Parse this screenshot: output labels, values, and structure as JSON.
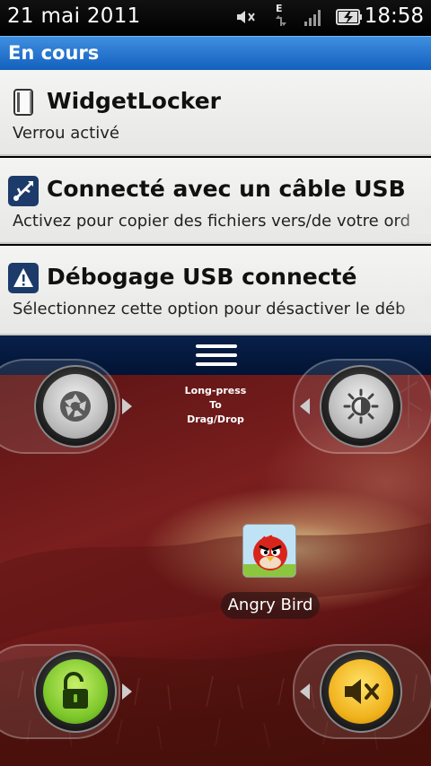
{
  "status_bar": {
    "date": "21 mai 2011",
    "time": "18:58",
    "icons": [
      "mute-icon",
      "edge-data-icon",
      "signal-icon",
      "battery-charging-icon"
    ],
    "network_letter": "E"
  },
  "notification_panel": {
    "header": "En cours",
    "items": [
      {
        "icon": "widgetlocker-icon",
        "title": "WidgetLocker",
        "subtitle": "Verrou activé"
      },
      {
        "icon": "usb-icon",
        "title": "Connecté avec un câble USB",
        "subtitle": "Activez pour copier des fichiers vers/de votre ord"
      },
      {
        "icon": "warning-icon",
        "title": "Débogage USB connecté",
        "subtitle": "Sélectionnez cette option pour désactiver le déb"
      }
    ],
    "handle_icon": "drag-handle-icon"
  },
  "lockscreen": {
    "widget_hint_lines": [
      "Long-press",
      "To",
      "Drag/Drop"
    ],
    "buttons": [
      "camera-slider",
      "brightness-slider",
      "unlock-slider",
      "mute-slider"
    ],
    "app_shortcut": {
      "label": "Angry Bird",
      "icon": "angry-bird-icon"
    }
  },
  "colors": {
    "header_blue": "#1d6fce",
    "handle_navy": "#061c40",
    "unlock_green": "#7bc62a",
    "mute_yellow": "#f0b21c"
  }
}
